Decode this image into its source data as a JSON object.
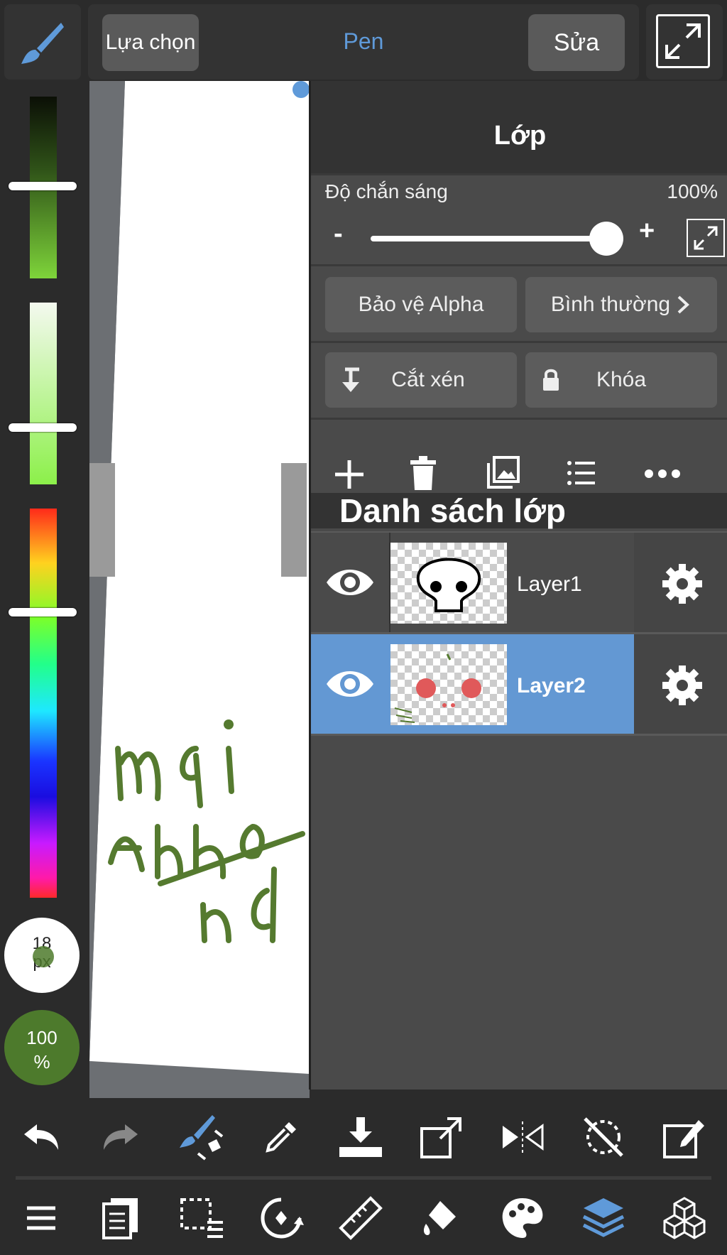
{
  "topbar": {
    "select_label": "Lựa chọn",
    "tool_name": "Pen",
    "edit_label": "Sửa"
  },
  "leftbar": {
    "brush_size": "18",
    "brush_unit": "px",
    "opacity_value": "100",
    "opacity_unit": "%",
    "sliders": {
      "brightness": 0.5,
      "saturation": 0.7,
      "hue": 0.27
    }
  },
  "canvas": {
    "drawing_text": [
      "mới",
      "Anh ơi",
      "nđ"
    ],
    "ink_color": "#557a2f"
  },
  "panel": {
    "title": "Lớp",
    "opacity_label": "Độ chắn sáng",
    "opacity_value": "100%",
    "opacity_level": 1.0,
    "minus": "-",
    "plus": "+",
    "alpha_protect": "Bảo vệ Alpha",
    "blend_mode": "Bình thường",
    "clipping": "Cắt xén",
    "lock": "Khóa",
    "list_title": "Danh sách lớp",
    "layers": [
      {
        "name": "Layer1",
        "selected": false
      },
      {
        "name": "Layer2",
        "selected": true
      }
    ]
  },
  "colors": {
    "accent": "#5f9ad9",
    "selected_row": "#6398d3",
    "brand_green": "#4d7a2c"
  },
  "bottom": {
    "row1": [
      "undo-icon",
      "redo-icon",
      "brush-swap-icon",
      "eyedropper-icon",
      "import-icon",
      "transform-icon",
      "flip-icon",
      "rotate-reset-icon",
      "edit-icon"
    ],
    "row2": [
      "menu-icon",
      "pages-icon",
      "selection-icon",
      "rotate-icon",
      "ruler-icon",
      "fill-icon",
      "palette-icon",
      "layers-icon",
      "material-icon"
    ]
  }
}
